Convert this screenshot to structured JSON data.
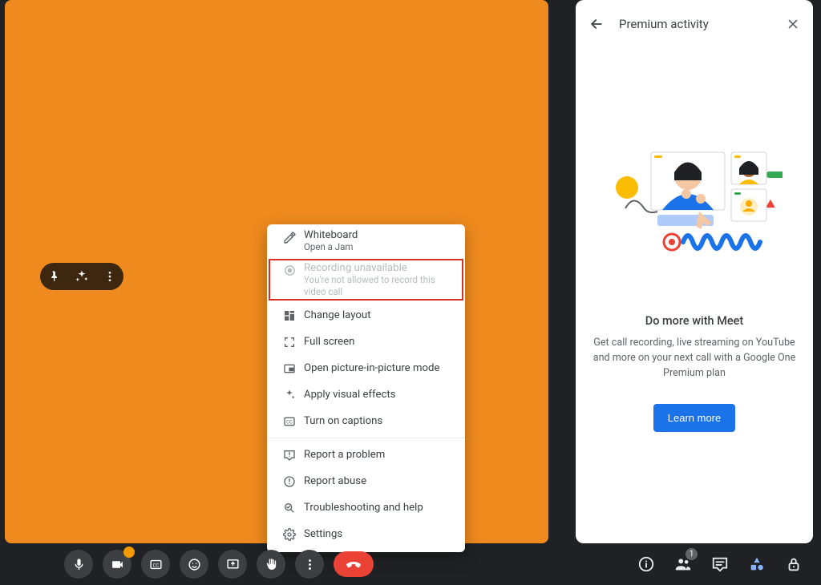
{
  "panel": {
    "title": "Premium activity",
    "heading": "Do more with Meet",
    "body": "Get call recording, live streaming on YouTube and more on your next call with a Google One Premium plan",
    "cta": "Learn more"
  },
  "menu": {
    "whiteboard": {
      "label": "Whiteboard",
      "sub": "Open a Jam"
    },
    "recording": {
      "label": "Recording unavailable",
      "sub": "You're not allowed to record this video call"
    },
    "layout": "Change layout",
    "fullscreen": "Full screen",
    "pip": "Open picture-in-picture mode",
    "effects": "Apply visual effects",
    "captions": "Turn on captions",
    "report": "Report a problem",
    "abuse": "Report abuse",
    "trouble": "Troubleshooting and help",
    "settings": "Settings"
  },
  "bottombar": {
    "people_count": "1"
  },
  "colors": {
    "tile": "#ef8b1e",
    "accent": "#1a73e8",
    "hang": "#ea4335"
  }
}
